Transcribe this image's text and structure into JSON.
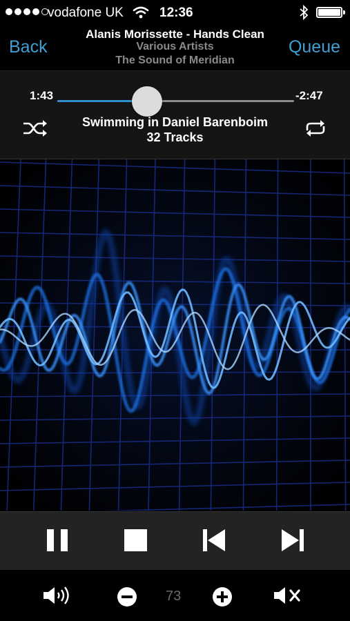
{
  "status_bar": {
    "signal_bars_filled": 4,
    "signal_bars_total": 5,
    "carrier": "vodafone UK",
    "time": "12:36",
    "icons": [
      "signal-dots-icon",
      "wifi-icon",
      "bluetooth-icon",
      "battery-icon"
    ],
    "battery_level": 1.0
  },
  "nav": {
    "back_label": "Back",
    "queue_label": "Queue",
    "now_playing_title": "Alanis Morissette - Hands Clean",
    "now_playing_artist": "Various Artists",
    "now_playing_album": "The Sound of Meridian"
  },
  "progress": {
    "elapsed": "1:43",
    "remaining": "-2:47",
    "fraction": 0.38
  },
  "playlist": {
    "name": "Swimming in Daniel Barenboim",
    "track_count": "32 Tracks"
  },
  "transport": {
    "icons": [
      "pause-icon",
      "stop-icon",
      "previous-track-icon",
      "next-track-icon"
    ]
  },
  "volume": {
    "value": "73",
    "icons": [
      "speaker-icon",
      "volume-down-icon",
      "volume-up-icon",
      "mute-icon"
    ]
  },
  "colors": {
    "accent": "#3e9fd3",
    "secondary_text": "#8a8a8a",
    "waveform_blue": "#2f8fff"
  }
}
